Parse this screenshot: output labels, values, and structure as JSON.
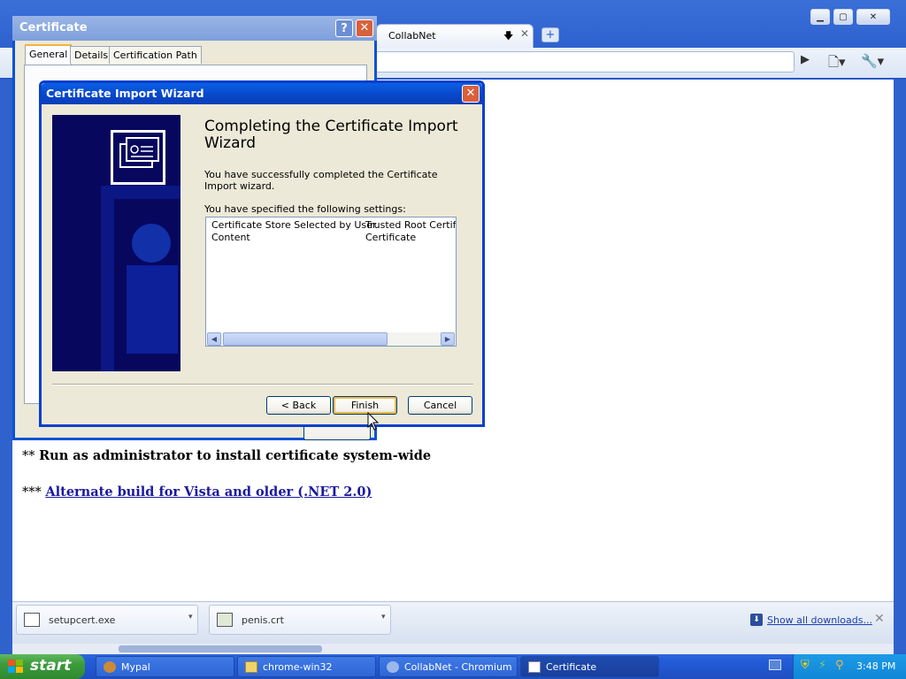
{
  "browser": {
    "tab_title": "CollabNet",
    "page": {
      "line1_prefix": "** ",
      "line1_text": "Run as administrator to install certificate system-wide",
      "line2_prefix": "*** ",
      "line2_link": "Alternate build for Vista and older (.NET 2.0)"
    },
    "downloads": [
      {
        "name": "setupcert.exe"
      },
      {
        "name": "penis.crt"
      }
    ],
    "show_all": "Show all downloads..."
  },
  "certificate_dialog": {
    "title": "Certificate",
    "tabs": [
      "General",
      "Details",
      "Certification Path"
    ],
    "active_tab": "General"
  },
  "wizard": {
    "title": "Certificate Import Wizard",
    "heading": "Completing the Certificate Import Wizard",
    "success_text": "You have successfully completed the Certificate Import wizard.",
    "settings_label": "You have specified the following settings:",
    "settings": [
      {
        "name": "Certificate Store Selected by User",
        "value": "Trusted Root Certific"
      },
      {
        "name": "Content",
        "value": "Certificate"
      }
    ],
    "buttons": {
      "back": "< Back",
      "finish": "Finish",
      "cancel": "Cancel"
    }
  },
  "taskbar": {
    "start": "start",
    "tasks": [
      {
        "label": "Mypal",
        "active": false
      },
      {
        "label": "chrome-win32",
        "active": false
      },
      {
        "label": "CollabNet - Chromium",
        "active": false
      },
      {
        "label": "Certificate",
        "active": true
      }
    ],
    "clock": "3:48 PM"
  },
  "colors": {
    "titlebar_blue": "#0a52d6",
    "dialog_bg": "#ece9d8",
    "link": "#1a19a0",
    "start_green": "#3c9a3c",
    "wizard_side": "#07075e"
  }
}
